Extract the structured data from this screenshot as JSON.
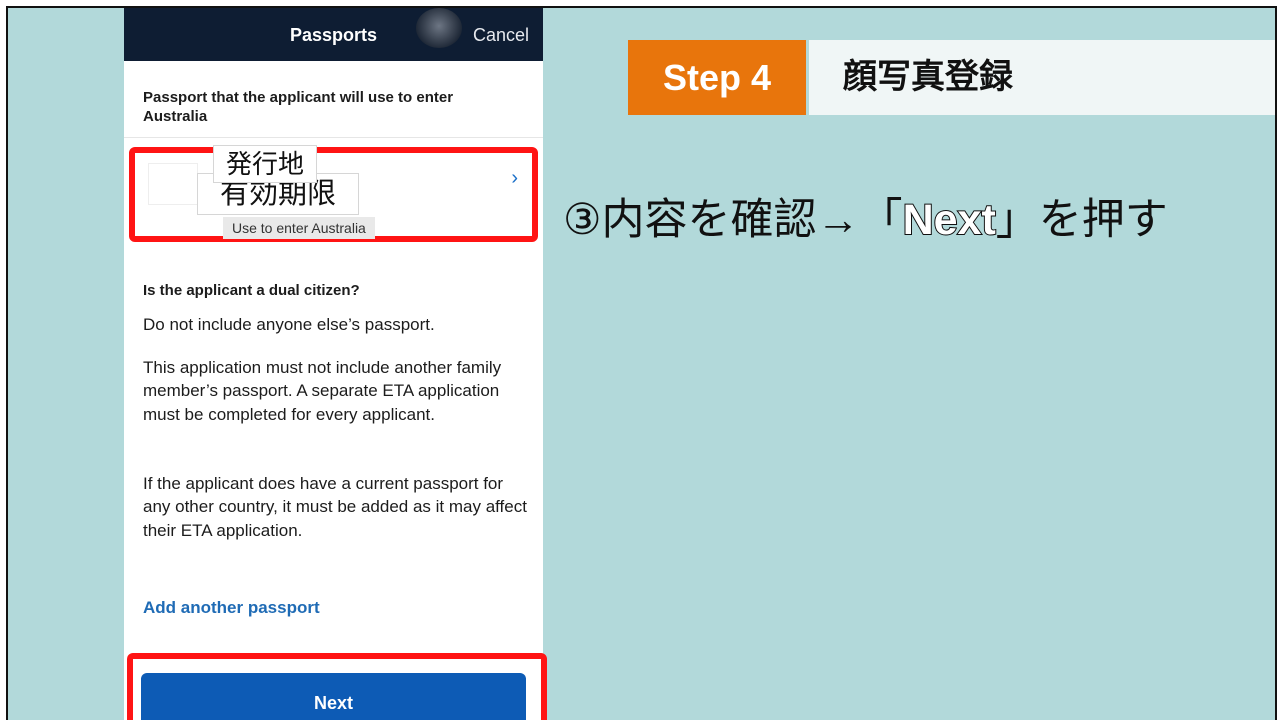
{
  "phone": {
    "header": {
      "title": "Passports",
      "cancel_label": "Cancel"
    },
    "passport_intro": "Passport that the applicant will use to enter Australia",
    "passport_card": {
      "issuer_label": "発行地",
      "expiry_label": "有効期限",
      "use_chip": "Use to enter Australia",
      "chevron": "›"
    },
    "dual_citizen_question": "Is the applicant a dual citizen?",
    "paragraph1": "Do not include anyone else’s passport.",
    "paragraph2": "This application must not include another family member’s passport. A separate ETA application must be completed for every applicant.",
    "paragraph3": "If the applicant does have a current passport for any other country, it must be added as it may affect their ETA application.",
    "add_passport_link": "Add another passport",
    "next_label": "Next"
  },
  "banner": {
    "step_label": "Step 4",
    "step_title": "顔写真登録"
  },
  "instruction": {
    "prefix": "③内容を確認→「",
    "highlight": "Next",
    "suffix": "」を押す"
  },
  "colors": {
    "header_bg": "#0e1d33",
    "highlight_red": "#ff1414",
    "next_blue": "#0d5bb5",
    "link_blue": "#1f6bb5",
    "step_orange": "#e8750c",
    "slide_bg": "#b2d9da"
  }
}
